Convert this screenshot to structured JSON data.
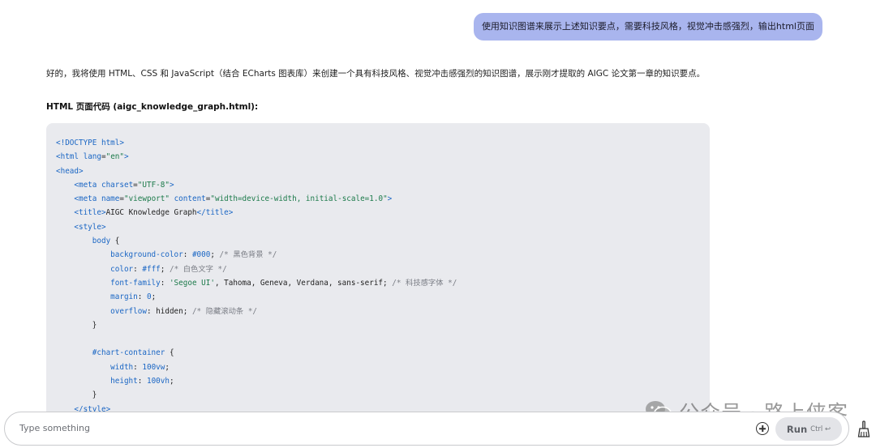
{
  "user_message": "使用知识图谱来展示上述知识要点，需要科技风格，视觉冲击感强烈，输出html页面",
  "assistant": {
    "intro": "好的，我将使用 HTML、CSS 和 JavaScript（结合 ECharts 图表库）来创建一个具有科技风格、视觉冲击感强烈的知识图谱，展示刚才提取的 AIGC 论文第一章的知识要点。",
    "code_heading": "HTML 页面代码 (aigc_knowledge_graph.html):",
    "code_lines": [
      [
        [
          "tk-tag",
          "<!DOCTYPE html>"
        ]
      ],
      [
        [
          "tk-tag",
          "<html "
        ],
        [
          "tk-attr",
          "lang"
        ],
        [
          "tk-punc",
          "="
        ],
        [
          "tk-str",
          "\"en\""
        ],
        [
          "tk-tag",
          ">"
        ]
      ],
      [
        [
          "tk-tag",
          "<head>"
        ]
      ],
      [
        [
          "tk-text",
          "    "
        ],
        [
          "tk-tag",
          "<meta "
        ],
        [
          "tk-attr",
          "charset"
        ],
        [
          "tk-punc",
          "="
        ],
        [
          "tk-str",
          "\"UTF-8\""
        ],
        [
          "tk-tag",
          ">"
        ]
      ],
      [
        [
          "tk-text",
          "    "
        ],
        [
          "tk-tag",
          "<meta "
        ],
        [
          "tk-attr",
          "name"
        ],
        [
          "tk-punc",
          "="
        ],
        [
          "tk-str",
          "\"viewport\""
        ],
        [
          "tk-text",
          " "
        ],
        [
          "tk-attr",
          "content"
        ],
        [
          "tk-punc",
          "="
        ],
        [
          "tk-str",
          "\"width=device-width, initial-scale=1.0\""
        ],
        [
          "tk-tag",
          ">"
        ]
      ],
      [
        [
          "tk-text",
          "    "
        ],
        [
          "tk-tag",
          "<title>"
        ],
        [
          "tk-text",
          "AIGC Knowledge Graph"
        ],
        [
          "tk-tag",
          "</title>"
        ]
      ],
      [
        [
          "tk-text",
          "    "
        ],
        [
          "tk-tag",
          "<style>"
        ]
      ],
      [
        [
          "tk-text",
          "        "
        ],
        [
          "tk-sel",
          "body"
        ],
        [
          "tk-punc",
          " {"
        ]
      ],
      [
        [
          "tk-text",
          "            "
        ],
        [
          "tk-prop",
          "background-color"
        ],
        [
          "tk-punc",
          ": "
        ],
        [
          "tk-num",
          "#000"
        ],
        [
          "tk-punc",
          "; "
        ],
        [
          "tk-comment",
          "/* 黑色背景 */"
        ]
      ],
      [
        [
          "tk-text",
          "            "
        ],
        [
          "tk-prop",
          "color"
        ],
        [
          "tk-punc",
          ": "
        ],
        [
          "tk-num",
          "#fff"
        ],
        [
          "tk-punc",
          "; "
        ],
        [
          "tk-comment",
          "/* 白色文字 */"
        ]
      ],
      [
        [
          "tk-text",
          "            "
        ],
        [
          "tk-prop",
          "font-family"
        ],
        [
          "tk-punc",
          ": "
        ],
        [
          "tk-str",
          "'Segoe UI'"
        ],
        [
          "tk-val",
          ", Tahoma, Geneva, Verdana, sans-serif"
        ],
        [
          "tk-punc",
          "; "
        ],
        [
          "tk-comment",
          "/* 科技感字体 */"
        ]
      ],
      [
        [
          "tk-text",
          "            "
        ],
        [
          "tk-prop",
          "margin"
        ],
        [
          "tk-punc",
          ": "
        ],
        [
          "tk-num",
          "0"
        ],
        [
          "tk-punc",
          ";"
        ]
      ],
      [
        [
          "tk-text",
          "            "
        ],
        [
          "tk-prop",
          "overflow"
        ],
        [
          "tk-punc",
          ": "
        ],
        [
          "tk-val",
          "hidden"
        ],
        [
          "tk-punc",
          "; "
        ],
        [
          "tk-comment",
          "/* 隐藏滚动条 */"
        ]
      ],
      [
        [
          "tk-text",
          "        "
        ],
        [
          "tk-punc",
          "}"
        ]
      ],
      [
        [
          "tk-text",
          ""
        ]
      ],
      [
        [
          "tk-text",
          "        "
        ],
        [
          "tk-sel",
          "#chart-container"
        ],
        [
          "tk-punc",
          " {"
        ]
      ],
      [
        [
          "tk-text",
          "            "
        ],
        [
          "tk-prop",
          "width"
        ],
        [
          "tk-punc",
          ": "
        ],
        [
          "tk-num",
          "100vw"
        ],
        [
          "tk-punc",
          ";"
        ]
      ],
      [
        [
          "tk-text",
          "            "
        ],
        [
          "tk-prop",
          "height"
        ],
        [
          "tk-punc",
          ": "
        ],
        [
          "tk-num",
          "100vh"
        ],
        [
          "tk-punc",
          ";"
        ]
      ],
      [
        [
          "tk-text",
          "        "
        ],
        [
          "tk-punc",
          "}"
        ]
      ],
      [
        [
          "tk-text",
          "    "
        ],
        [
          "tk-tag",
          "</style>"
        ]
      ]
    ]
  },
  "watermark": {
    "text": "公众号 · 路上侠客"
  },
  "composer": {
    "placeholder": "Type something",
    "run_label": "Run",
    "run_shortcut": "Ctrl ↩"
  },
  "colors": {
    "user_bubble": "#a9b5ee",
    "code_bg": "#e9eaee",
    "code_tag": "#1a66c4",
    "code_string": "#1c7a4a",
    "code_comment": "#7a7d85"
  },
  "icons": {
    "add": "plus-circle-icon",
    "clear": "broom-icon",
    "watermark_logo": "wechat-icon"
  }
}
